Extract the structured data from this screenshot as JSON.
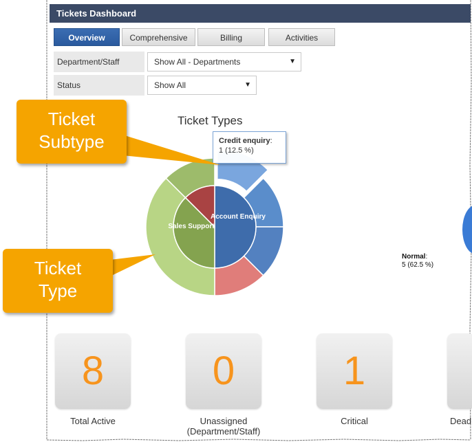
{
  "dashboard": {
    "title": "Tickets Dashboard",
    "tabs": [
      {
        "label": "Overview",
        "active": true
      },
      {
        "label": "Comprehensive",
        "active": false
      },
      {
        "label": "Billing",
        "active": false
      },
      {
        "label": "Activities",
        "active": false
      }
    ]
  },
  "filters": {
    "department_label": "Department/Staff",
    "department_value": "Show All - Departments",
    "status_label": "Status",
    "status_value": "Show All"
  },
  "chart": {
    "title": "Ticket Types",
    "inner_labels": [
      "Account Enquiry",
      "Sales Support"
    ],
    "tooltip": {
      "name": "Credit enquiry",
      "value": "1 (12.5 %)"
    },
    "side_label": {
      "name": "Normal",
      "value": "5 (62.5 %)"
    }
  },
  "chart_data": {
    "type": "pie",
    "title": "Ticket Types",
    "inner_ring": [
      {
        "name": "Account Enquiry",
        "value": 4,
        "color": "#3e6cab"
      },
      {
        "name": "Sales Support",
        "value": 3,
        "color": "#84a34f"
      },
      {
        "name": "",
        "value": 1,
        "color": "#a94343"
      }
    ],
    "outer_ring": [
      {
        "name": "Credit enquiry",
        "value": 1,
        "color": "#7aa6de"
      },
      {
        "name": "",
        "value": 1,
        "color": "#5a8dcb"
      },
      {
        "name": "",
        "value": 1,
        "color": "#5381c0"
      },
      {
        "name": "",
        "value": 1,
        "color": "#e07d7a"
      },
      {
        "name": "",
        "value": 3,
        "color": "#b8d585"
      },
      {
        "name": "",
        "value": 1,
        "color": "#9dbb6b"
      }
    ]
  },
  "callouts": [
    {
      "label": "Ticket Subtype"
    },
    {
      "label": "Ticket Type"
    }
  ],
  "stats": [
    {
      "value": "8",
      "label": "Total Active"
    },
    {
      "value": "0",
      "label": "Unassigned (Department/Staff)"
    },
    {
      "value": "1",
      "label": "Critical"
    },
    {
      "value": "",
      "label": "Dead"
    }
  ],
  "colors": {
    "titlebar": "#3b4a66",
    "tab_active": "#2a5a9e",
    "callout": "#f5a400",
    "stat_value": "#f7941d"
  }
}
